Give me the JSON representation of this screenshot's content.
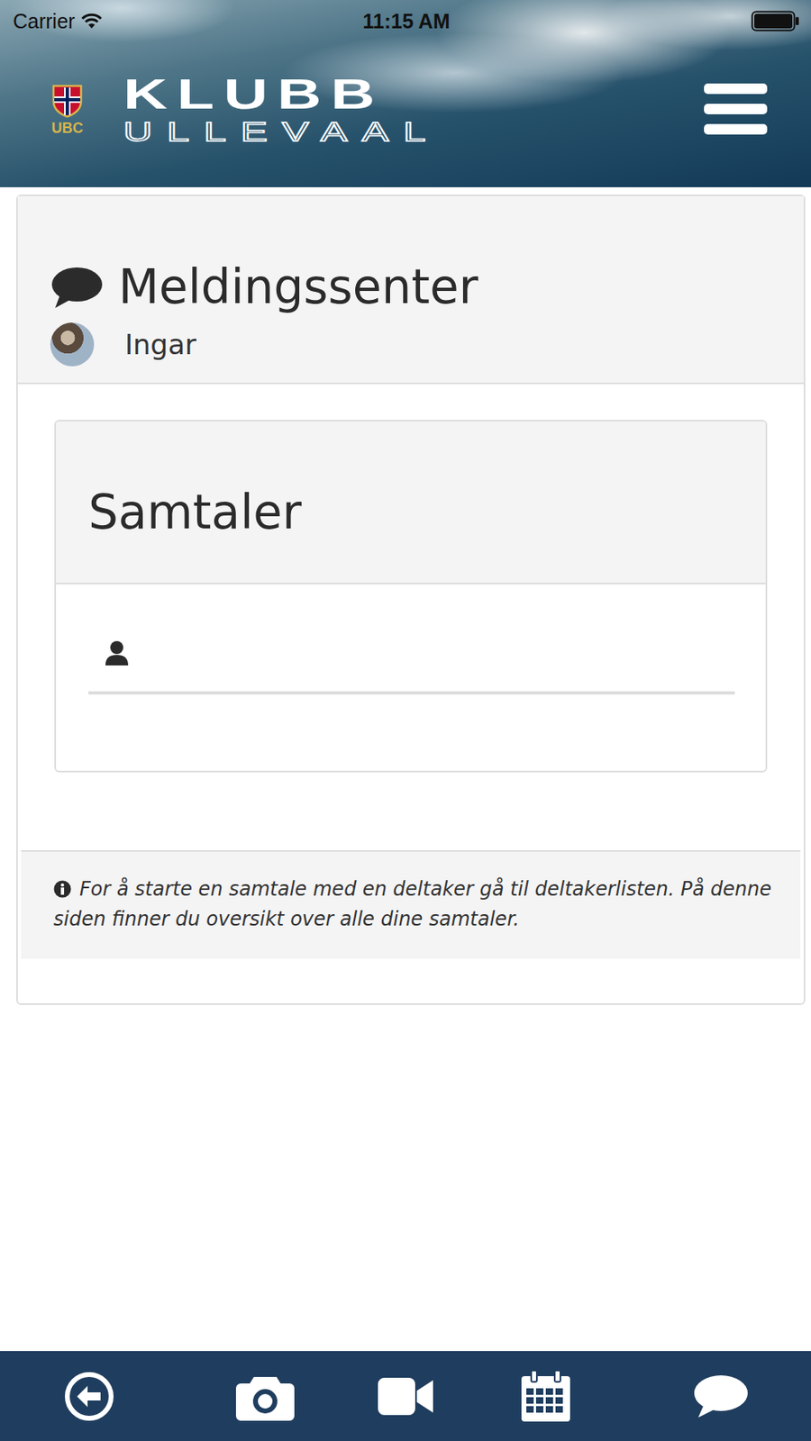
{
  "status_bar": {
    "carrier": "Carrier",
    "time": "11:15 AM"
  },
  "header": {
    "badge": "UBC",
    "brand_top": "KLUBB",
    "brand_bottom": "ULLEVAAL"
  },
  "page": {
    "title": "Meldingssenter",
    "user": "Ingar"
  },
  "conversations": {
    "title": "Samtaler"
  },
  "info": "For å starte en samtale med en deltaker gå til deltakerlisten. På denne siden finner du oversikt over alle dine samtaler."
}
